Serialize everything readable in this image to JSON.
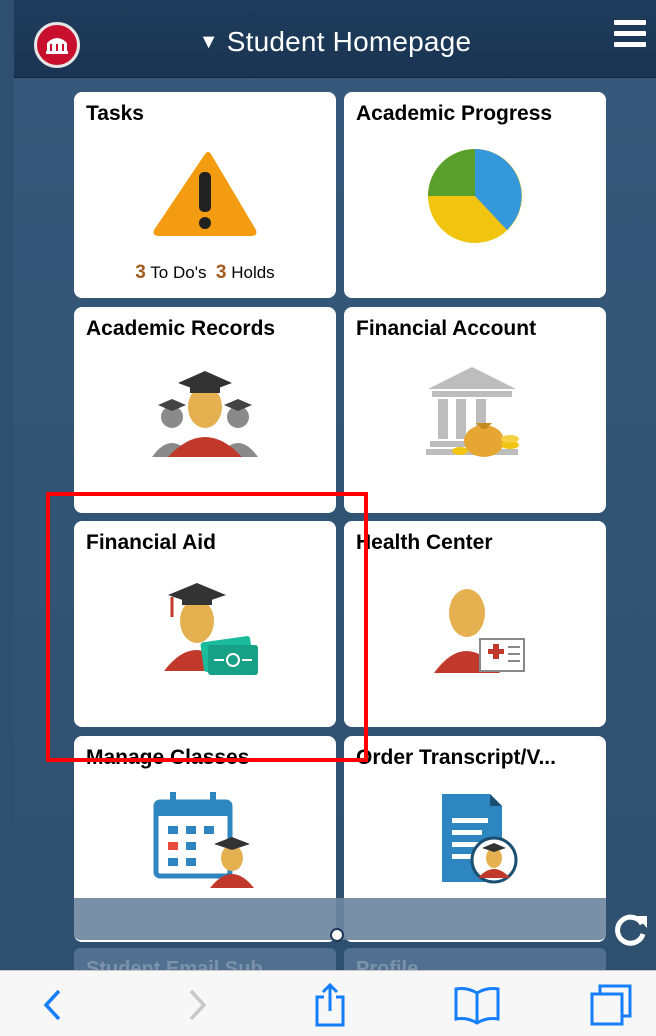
{
  "header": {
    "title": "Student Homepage",
    "menu_icon": "hamburger-menu-icon",
    "logo": "university-seal-logo"
  },
  "tiles": [
    {
      "title": "Tasks",
      "icon": "warning-triangle-icon",
      "todos_count": "3",
      "todos_label": "To Do's",
      "holds_count": "3",
      "holds_label": "Holds"
    },
    {
      "title": "Academic Progress",
      "icon": "pie-chart-icon"
    },
    {
      "title": "Academic Records",
      "icon": "graduates-group-icon"
    },
    {
      "title": "Financial Account",
      "icon": "bank-money-icon"
    },
    {
      "title": "Financial Aid",
      "icon": "graduate-money-icon"
    },
    {
      "title": "Health Center",
      "icon": "person-medical-card-icon"
    },
    {
      "title": "Manage Classes",
      "icon": "calendar-graduate-icon"
    },
    {
      "title": "Order Transcript/V...",
      "icon": "document-graduate-icon"
    },
    {
      "title": "Student Email Sub",
      "icon": ""
    },
    {
      "title": "Profile",
      "icon": ""
    }
  ],
  "colors": {
    "header": "#1f3c5c",
    "background": "#2f4f6e",
    "highlight": "#ff0000",
    "count_accent": "#a35b1c"
  },
  "toolbar": {
    "items": [
      "back-icon",
      "forward-icon",
      "share-icon",
      "bookmarks-icon",
      "tabs-icon"
    ]
  }
}
